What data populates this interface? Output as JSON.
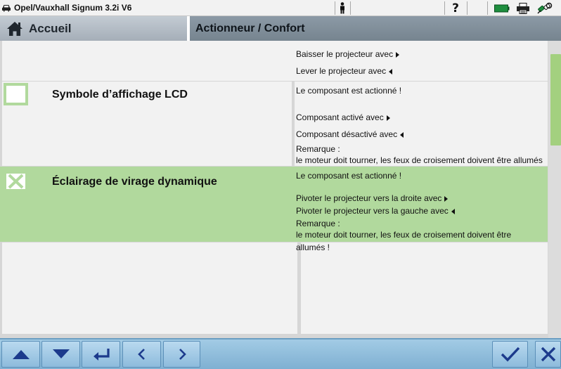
{
  "window": {
    "title": "Opel/Vauxhall Signum 3.2i V6"
  },
  "header": {
    "home_label": "Accueil",
    "section_label": "Actionneur / Confort"
  },
  "rows": {
    "top_info": {
      "line1": "Baisser le projecteur avec",
      "line2": "Lever le projecteur avec"
    },
    "lcd": {
      "title": "Symbole d’affichage LCD",
      "checked": false,
      "status": "Le composant est actionné !",
      "line_on": "Composant activé avec",
      "line_off": "Composant désactivé avec",
      "note_label": "Remarque :",
      "note": "le moteur doit tourner, les feux de croisement doivent être allumés"
    },
    "eclairage": {
      "title": "Éclairage de virage dynamique",
      "checked": true,
      "status": "Le composant est actionné !",
      "line_right": "Pivoter le projecteur vers la droite avec",
      "line_left": "Pivoter le projecteur vers la gauche avec",
      "note_label": "Remarque :",
      "note_line1": "le moteur doit tourner, les feux de croisement doivent être",
      "note_line2": "allumés !"
    }
  },
  "icons": {
    "car": "car-icon",
    "person": "person-icon",
    "help": "question-mark-icon",
    "battery": "battery-icon",
    "printer": "printer-icon",
    "connection": "connection-icon",
    "home": "home-icon",
    "nav_up": "arrow-up-icon",
    "nav_down": "arrow-down-icon",
    "nav_enter": "enter-icon",
    "nav_prev": "chevron-left-icon",
    "nav_next": "chevron-right-icon",
    "confirm": "check-icon",
    "close": "close-icon"
  },
  "colors": {
    "highlight_green": "#b1d99d",
    "nav_blue": "#8dbbdc",
    "icon_navy": "#1c3a8c",
    "battery_green": "#1e8e3e"
  }
}
